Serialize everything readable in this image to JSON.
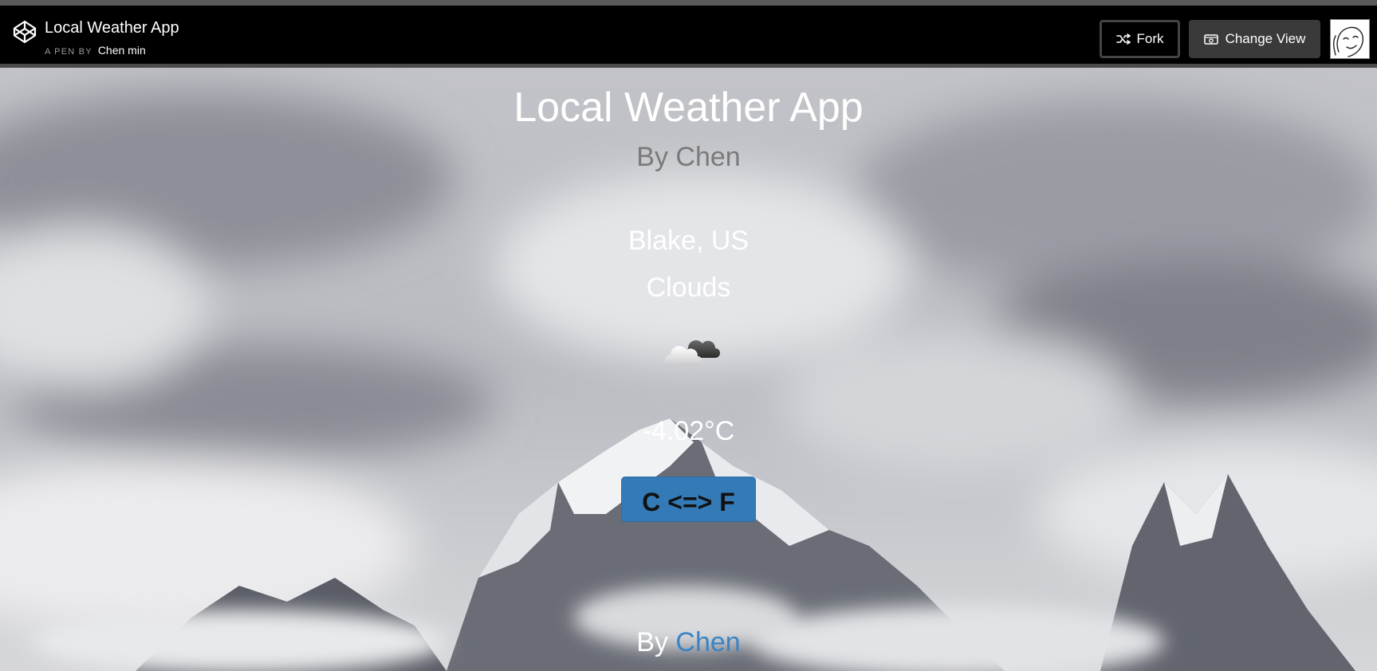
{
  "topbar": {
    "title": "Local Weather App",
    "by_label": "A PEN BY",
    "author": "Chen min",
    "fork_label": "Fork",
    "change_view_label": "Change View",
    "icons": [
      "codepen-logo-icon",
      "fork-icon",
      "eye-icon",
      "avatar"
    ]
  },
  "app": {
    "title": "Local Weather App",
    "subtitle": "By Chen",
    "location": "Blake, US",
    "condition": "Clouds",
    "weather_icon": "cloud-icon",
    "temperature": "-4.02°C",
    "toggle_label": "C <=> F",
    "footer_by": "By",
    "footer_link": "Chen"
  },
  "colors": {
    "topbar_bg": "#000000",
    "button_primary": "#337ab7",
    "link": "#3a84c4",
    "subtitle": "#7a7a7a"
  }
}
